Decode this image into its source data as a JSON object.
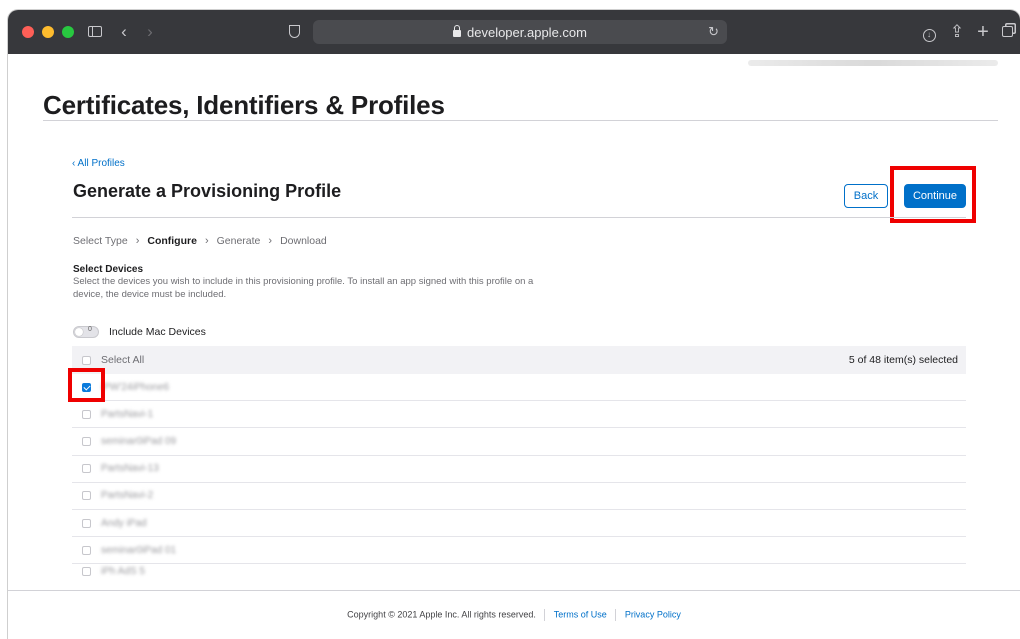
{
  "browser": {
    "url": "developer.apple.com",
    "icons": [
      "sidebar-icon",
      "back-icon",
      "forward-icon",
      "shield-icon",
      "lock-icon",
      "reload-icon",
      "download-icon",
      "share-icon",
      "new-tab-icon",
      "tabs-overview-icon"
    ]
  },
  "page": {
    "title": "Certificates, Identifiers & Profiles"
  },
  "profile": {
    "back_link": "‹ All Profiles",
    "title": "Generate a Provisioning Profile",
    "back_button": "Back",
    "continue_button": "Continue"
  },
  "steps": [
    {
      "label": "Select Type",
      "active": false
    },
    {
      "label": "Configure",
      "active": true
    },
    {
      "label": "Generate",
      "active": false
    },
    {
      "label": "Download",
      "active": false
    }
  ],
  "step_separator": "›",
  "devices": {
    "heading": "Select Devices",
    "description": "Select the devices you wish to include in this provisioning profile. To install an app signed with this profile on a device, the device must be included.",
    "include_mac_label": "Include Mac Devices",
    "toggle_state": "0",
    "select_all_label": "Select All",
    "selection_count": "5 of 48 item(s) selected",
    "rows": [
      {
        "name": "iPW'24iPhone6",
        "checked": true
      },
      {
        "name": "PartsNavi-1",
        "checked": false
      },
      {
        "name": "seminar0iPad 09",
        "checked": false
      },
      {
        "name": "PartsNavi-13",
        "checked": false
      },
      {
        "name": "PartsNavi-2",
        "checked": false
      },
      {
        "name": "Andy iPad",
        "checked": false
      },
      {
        "name": "seminar0iPad 01",
        "checked": false
      },
      {
        "name": "iPh AdS 5",
        "checked": false
      }
    ]
  },
  "footer": {
    "copyright": "Copyright © 2021 Apple Inc. All rights reserved.",
    "terms": "Terms of Use",
    "privacy": "Privacy Policy"
  },
  "colors": {
    "accent": "#0070c9",
    "highlight": "#ef0000",
    "toolbar": "#37383c"
  }
}
